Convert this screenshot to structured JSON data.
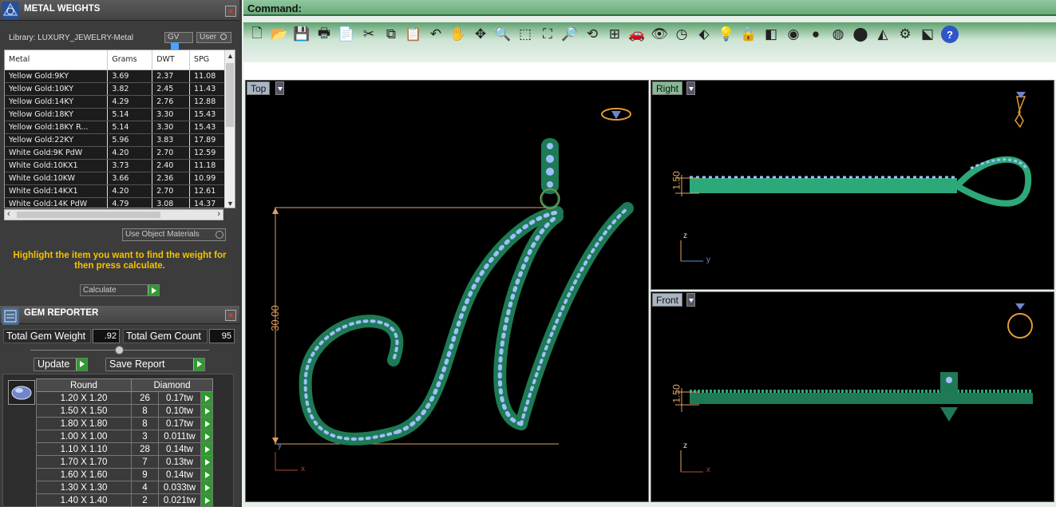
{
  "metal_weights": {
    "title": "METAL WEIGHTS",
    "library_label": "Library: LUXURY_JEWELRY-Metal",
    "gv_label": "GV",
    "user_label": "User",
    "columns": [
      "Metal",
      "Grams",
      "DWT",
      "SPG"
    ],
    "rows": [
      [
        "Yellow Gold:9KY",
        "3.69",
        "2.37",
        "11.08"
      ],
      [
        "Yellow Gold:10KY",
        "3.82",
        "2.45",
        "11.43"
      ],
      [
        "Yellow Gold:14KY",
        "4.29",
        "2.76",
        "12.88"
      ],
      [
        "Yellow Gold:18KY",
        "5.14",
        "3.30",
        "15.43"
      ],
      [
        "Yellow Gold:18KY R...",
        "5.14",
        "3.30",
        "15.43"
      ],
      [
        "Yellow Gold:22KY",
        "5.96",
        "3.83",
        "17.89"
      ],
      [
        "White Gold:9K PdW",
        "4.20",
        "2.70",
        "12.59"
      ],
      [
        "White Gold:10KX1",
        "3.73",
        "2.40",
        "11.18"
      ],
      [
        "White Gold:10KW",
        "3.66",
        "2.36",
        "10.99"
      ],
      [
        "White Gold:14KX1",
        "4.20",
        "2.70",
        "12.61"
      ],
      [
        "White Gold:14K PdW",
        "4.79",
        "3.08",
        "14.37"
      ]
    ],
    "use_object_materials": "Use Object Materials",
    "hint": "Highlight the item you want to find the weight for then press calculate.",
    "calculate_label": "Calculate"
  },
  "gem_reporter": {
    "title": "GEM REPORTER",
    "total_weight_label": "Total Gem Weight",
    "total_weight_value": ".92",
    "total_count_label": "Total Gem Count",
    "total_count_value": "95",
    "update_label": "Update",
    "save_report_label": "Save Report",
    "columns": [
      "Round",
      "Diamond"
    ],
    "rows": [
      [
        "1.20 X 1.20",
        "26",
        "0.17tw"
      ],
      [
        "1.50 X 1.50",
        "8",
        "0.10tw"
      ],
      [
        "1.80 X 1.80",
        "8",
        "0.17tw"
      ],
      [
        "1.00 X 1.00",
        "3",
        "0.011tw"
      ],
      [
        "1.10 X 1.10",
        "28",
        "0.14tw"
      ],
      [
        "1.70 X 1.70",
        "7",
        "0.13tw"
      ],
      [
        "1.60 X 1.60",
        "9",
        "0.14tw"
      ],
      [
        "1.30 X 1.30",
        "4",
        "0.033tw"
      ],
      [
        "1.40 X 1.40",
        "2",
        "0.021tw"
      ]
    ]
  },
  "command": {
    "label": "Command:"
  },
  "toolbar_icons": [
    "new-icon",
    "open-icon",
    "save-icon",
    "print-icon",
    "import-icon",
    "cut-icon",
    "copy-icon",
    "paste-icon",
    "undo-icon",
    "pan-icon",
    "move-icon",
    "zoom-icon",
    "zoom-window-icon",
    "zoom-extents-icon",
    "zoom-selected-icon",
    "rotate-view-icon",
    "four-viewports-icon",
    "car-icon",
    "eye-icon",
    "clock-icon",
    "snap-icon",
    "bulb-icon",
    "lock-icon",
    "layers-icon",
    "color-wheel-icon",
    "sphere-icon",
    "shaded-sphere-icon",
    "render-sphere-icon",
    "light-icon",
    "gear-icon",
    "select-icon",
    "help-icon"
  ],
  "viewports": {
    "top": {
      "label": "Top",
      "dimension": "30.00",
      "axis_x": "x",
      "axis_y": "y"
    },
    "right": {
      "label": "Right",
      "dimension": "1.50",
      "axis_a": "y",
      "axis_b": "z"
    },
    "front": {
      "label": "Front",
      "dimension": "1.50",
      "axis_a": "x",
      "axis_b": "z"
    }
  }
}
